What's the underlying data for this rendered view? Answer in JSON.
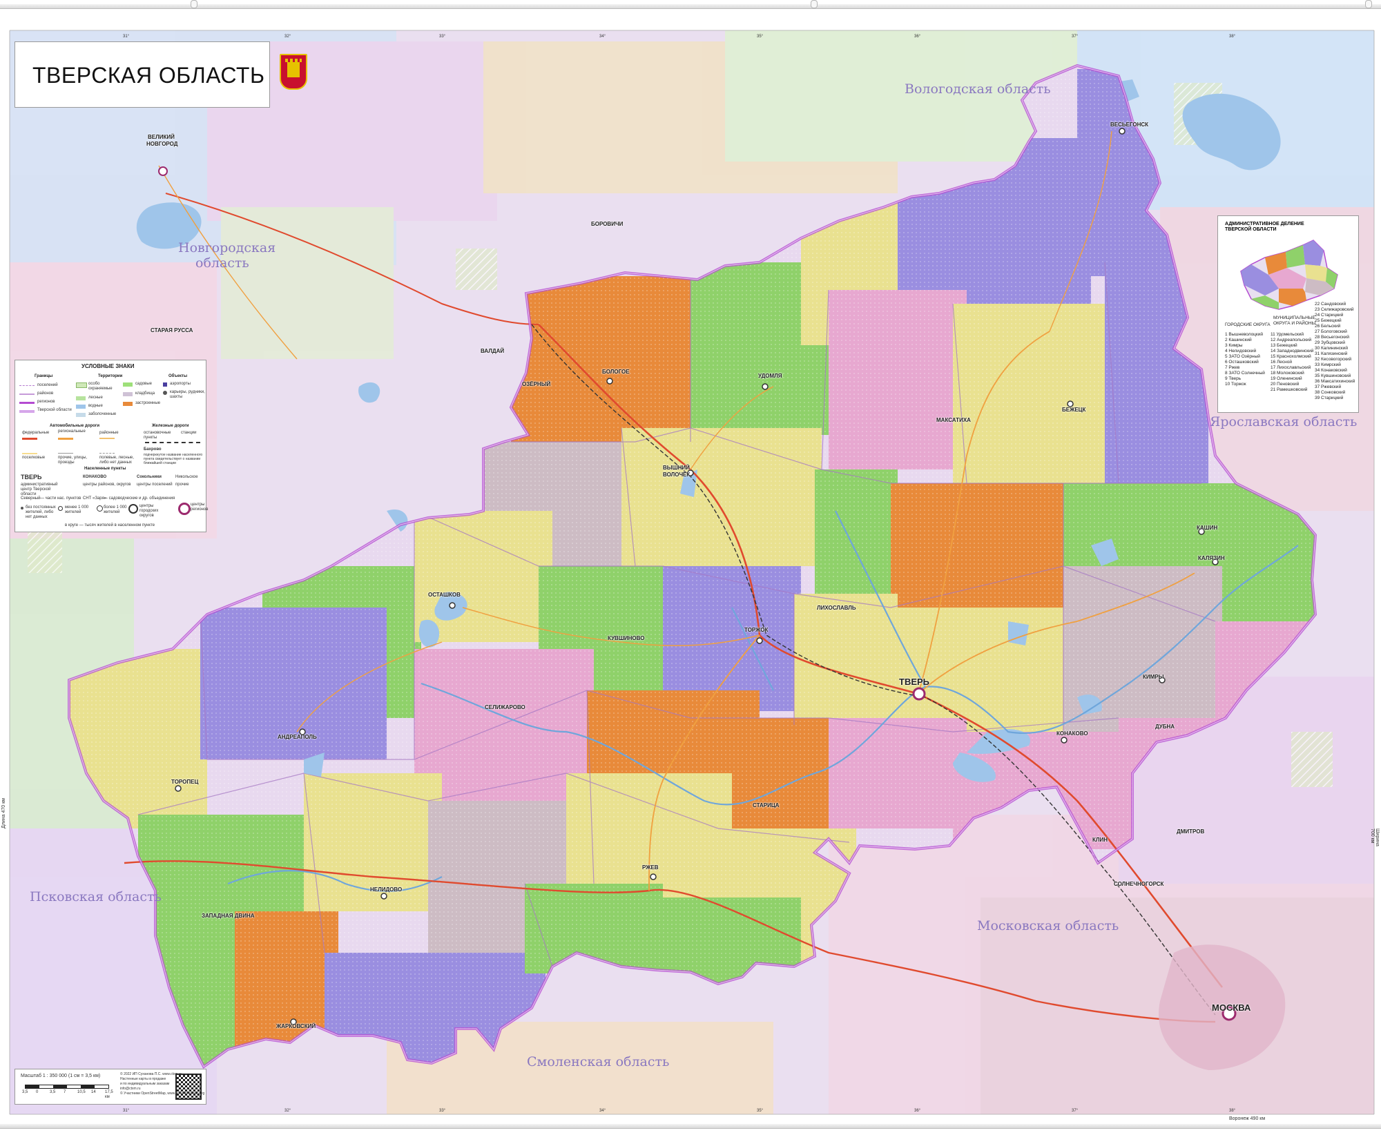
{
  "title": "ТВЕРСКАЯ ОБЛАСТЬ",
  "colors": {
    "tver_border": "#b44bd1",
    "outside_bg": "#e9e0ee",
    "orange": "#e88a3a",
    "green": "#8fd16a",
    "violet": "#9a8ee0",
    "pink": "#e7a8d0",
    "yellow": "#e9e190",
    "road_main": "#e04a2e",
    "water": "#9fc5ea"
  },
  "neighbor_regions": {
    "vologda": "Вологодская область",
    "novgorod_1": "Новгородская",
    "novgorod_2": "область",
    "yaroslavl": "Ярославская область",
    "pskov": "Псковская область",
    "moscow": "Московская область",
    "smolensk": "Смоленская область"
  },
  "cities": {
    "tver": "ТВЕРЬ",
    "moskva": "МОСКВА",
    "bologoe": "БОЛОГОЕ",
    "udomlya": "УДОМЛЯ",
    "vyshny_volochek_1": "ВЫШНИЙ",
    "vyshny_volochek_2": "ВОЛОЧЁК",
    "ostashkov": "ОСТАШКОВ",
    "torzhok": "ТОРЖОК",
    "kimry": "КИМРЫ",
    "kashin": "КАШИН",
    "kalyazin": "КАЛЯЗИН",
    "bezhetsk": "БЕЖЕЦК",
    "konakovo": "КОНАКОВО",
    "rzhev": "РЖЕВ",
    "nelidovo": "НЕЛИДОВО",
    "toropets": "ТОРОПЕЦ",
    "andreapol": "АНДРЕАПОЛЬ",
    "vesyegonsk": "ВЕСЬЕГОНСК",
    "zharkovsky": "ЖАРКОВСКИЙ",
    "veliky_novgorod_1": "ВЕЛИКИЙ",
    "veliky_novgorod_2": "НОВГОРОД",
    "staritsa": "СТАРИЦА",
    "kuvshinovo": "КУВШИНОВО",
    "likhoslavl": "ЛИХОСЛАВЛЬ",
    "dubna": "ДУБНА",
    "klin": "КЛИН",
    "dmitrov": "ДМИТРОВ",
    "solnechnogorsk": "СОЛНЕЧНОГОРСК",
    "borovichi": "БОРОВИЧИ",
    "staraya_russa": "СТАРАЯ РУССА",
    "valday": "ВАЛДАЙ",
    "ozyorny": "ОЗЁРНЫЙ",
    "maksatikha": "МАКСАТИХА",
    "zapadnaya_dvina": "ЗАПАДНАЯ ДВИНА",
    "selizharovo": "СЕЛИЖАРОВО"
  },
  "legend": {
    "title": "УСЛОВНЫЕ ЗНАКИ",
    "borders_h": "Границы",
    "borders": [
      "поселений",
      "районов",
      "регионов",
      "Тверской области"
    ],
    "territories_h": "Территории",
    "territories": [
      "особо охраняемые",
      "лесные",
      "водные",
      "заболоченные",
      "садовые",
      "кладбища",
      "застроенные"
    ],
    "objects_h": "Объекты",
    "objects": [
      "аэропорты",
      "карьеры, рудники, шахты"
    ],
    "roads_h": "Автомобильные дороги",
    "roads": [
      "федеральные",
      "региональные",
      "районные",
      "поселковые",
      "прочие, улицы, проезды",
      "полевые, лесные, либо нет данных"
    ],
    "rail_h": "Железные дороги",
    "rail": [
      "остановочные пункты",
      "станции",
      "Бахрово",
      "подчеркнутое название населенного пункта свидетельствует о названии ближайшей станции"
    ],
    "settle_h": "Населенные пункты",
    "settle_tver": "ТВЕРЬ",
    "settle_tver_desc": "административный центр Тверской области",
    "settle_konakovo": "КОНАКОВО",
    "settle_konakovo_desc": "центры районов, округов",
    "settle_sokolniki": "Сокольники",
    "settle_sokolniki_desc": "центры поселений",
    "settle_other": "Никольское",
    "settle_other_desc": "прочие",
    "settle_row2": [
      "Северный",
      "— части нас. пунктов",
      "СНТ «Заря»",
      "— садоводческие и др. объединения"
    ],
    "pop": [
      "без постоянных жителей, либо нет данных",
      "менее 1 000 жителей",
      "более 1 000 жителей",
      "центры городских округов",
      "центры регионов"
    ],
    "pop_note": "в круге — тысяч жителей в населенном пункте"
  },
  "admin": {
    "title_1": "АДМИНИСТРАТИВНОЕ ДЕЛЕНИЕ",
    "title_2": "ТВЕРСКОЙ ОБЛАСТИ",
    "urban_h": "ГОРОДСКИЕ ОКРУГА",
    "municipal_h_1": "МУНИЦИПАЛЬНЫЕ",
    "municipal_h_2": "ОКРУГА И РАЙОНЫ",
    "col1": [
      "1 Вышневолоцкий",
      "2 Кашинский",
      "3 Кимры",
      "4 Нелидовский",
      "5 ЗАТО Озёрный",
      "6 Осташковский",
      "7 Ржев",
      "8 ЗАТО Солнечный",
      "9 Тверь",
      "10 Торжок"
    ],
    "col2": [
      "11 Удомельский",
      "12 Андреапольский",
      "13 Бежецкий",
      "14 Западнодвинский",
      "15 Краснохолмский",
      "16 Лесной",
      "17 Лихославльский",
      "18 Молоковский",
      "19 Оленинский",
      "20 Пеновский",
      "21 Рамешковский"
    ],
    "col3": [
      "22 Сандовский",
      "23 Селижаровский",
      "24 Старицкий",
      "25 Бежецкий",
      "26 Бельский",
      "27 Бологовский",
      "28 Весьегонский",
      "29 Зубцовский",
      "30 Калининский",
      "31 Калязинский",
      "32 Кесовогорский",
      "33 Кимрский",
      "34 Конаковский",
      "35 Кувшиновский",
      "36 Максатихинский",
      "37 Ржевский",
      "38 Сонковский",
      "39 Старицкий"
    ]
  },
  "scale": {
    "label": "Масштаб 1 : 350 000   (1 см = 3,5 км)",
    "ticks": [
      "3,5",
      "0",
      "3,5",
      "7",
      "10,5",
      "14",
      "17,5 км"
    ]
  },
  "copyright": [
    "© 2022 ИП Суханова П.С. www.ctxm.ru",
    "Настенные карты в продаже",
    "и по индивидуальным заказам",
    "info@ctxm.ru",
    "© Участники OpenStreetMap, www.openstreetmap.org"
  ],
  "frame": {
    "left_side": "Длина 470 км",
    "right_side": "Ширина 700 км",
    "bottom_right": "Воронеж 490 км",
    "top_ticks": [
      "31°",
      "32°",
      "33°",
      "34°",
      "35°",
      "36°",
      "37°",
      "38°"
    ],
    "bottom_ticks": [
      "31°",
      "32°",
      "33°",
      "34°",
      "35°",
      "36°",
      "37°",
      "38°"
    ]
  }
}
